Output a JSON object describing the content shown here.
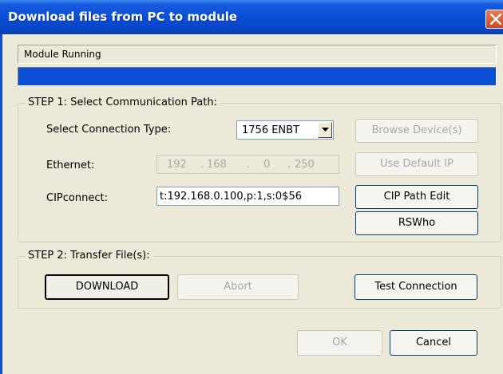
{
  "window": {
    "title": "Download files from PC to module"
  },
  "status": {
    "text": "Module Running",
    "progress": 1.0
  },
  "step1": {
    "title": "STEP 1: Select Communication Path:",
    "connection_type_label": "Select Connection Type:",
    "connection_type_value": "1756 ENBT",
    "browse_device_label": "Browse Device(s)",
    "ethernet_label": "Ethernet:",
    "ip": {
      "o1": "192",
      "o2": "168",
      "o3": "0",
      "o4": "250"
    },
    "use_default_ip_label": "Use Default IP",
    "cipconnect_label": "CIPconnect:",
    "cipconnect_value": "t:192.168.0.100,p:1,s:0$56",
    "cip_path_edit_label": "CIP Path Edit",
    "rswho_label": "RSWho"
  },
  "step2": {
    "title": "STEP 2: Transfer File(s):",
    "download_label": "DOWNLOAD",
    "abort_label": "Abort",
    "test_connection_label": "Test Connection"
  },
  "footer": {
    "ok_label": "OK",
    "cancel_label": "Cancel"
  },
  "colors": {
    "titlebar": "#0a4fd6",
    "dialog_bg": "#ece9d8",
    "progress_fill": "#0a4fd6",
    "close_button": "#d3461f"
  },
  "icons": {
    "close": "close-icon",
    "dropdown": "chevron-down-icon"
  }
}
